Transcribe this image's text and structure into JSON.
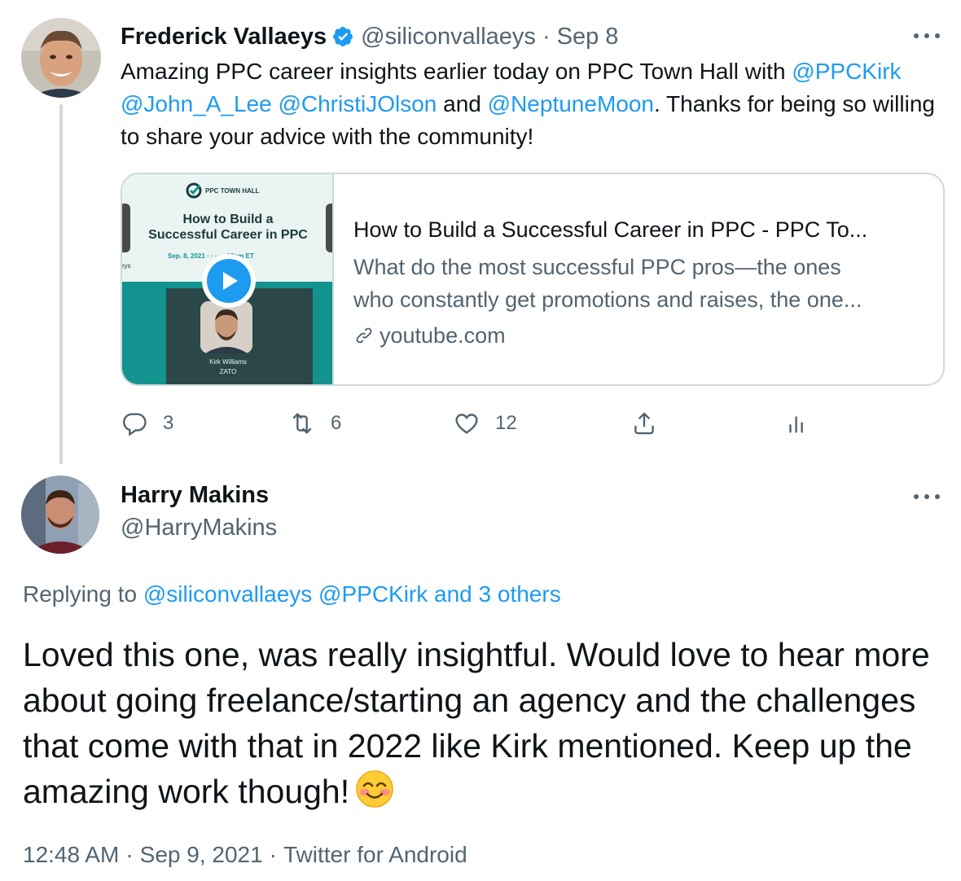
{
  "tweet": {
    "author_name": "Frederick Vallaeys",
    "author_handle": "@siliconvallaeys",
    "separator": "·",
    "date": "Sep 8",
    "text_segments": {
      "s1": "Amazing PPC career insights earlier today on PPC Town Hall with ",
      "m1": "@PPCKirk",
      "m2": "@John_A_Lee",
      "m3": "@ChristiJOlson",
      "s2": " and ",
      "m4": "@NeptuneMoon",
      "s3": ". Thanks for being so willing to share your advice with the community!"
    },
    "card": {
      "thumb_brand": "PPC TOWN HALL",
      "thumb_title_1": "How to Build a",
      "thumb_title_2": "Successful Career in PPC",
      "thumb_date": "Sep. 8, 2021 · · · · · 12pm ET",
      "thumb_left_text": "eys",
      "thumb_person_name": "Kirk Williams",
      "thumb_person_company": "ZATO",
      "title": "How to Build a Successful Career in PPC - PPC To...",
      "desc_line1": "What do the most successful PPC pros—the ones",
      "desc_line2": "who constantly get promotions and raises, the one...",
      "domain": "youtube.com"
    },
    "actions": {
      "replies": "3",
      "retweets": "6",
      "likes": "12"
    }
  },
  "reply": {
    "author_name": "Harry Makins",
    "author_handle": "@HarryMakins",
    "replying_prefix": "Replying to ",
    "replying_mentions": "@siliconvallaeys @PPCKirk and 3 others",
    "text": "Loved this one, was really insightful. Would love to hear more about going freelance/starting an agency and the challenges that come with that in 2022 like Kirk mentioned. Keep up the amazing work though!",
    "emoji": "smiling-face-with-smiling-eyes",
    "time": "12:48 AM",
    "date": "Sep 9, 2021",
    "source": "Twitter for Android",
    "separator": "·"
  },
  "colors": {
    "accent": "#1d9bf0",
    "text": "#0f1419",
    "muted": "#536471",
    "border": "#cfd9de"
  }
}
